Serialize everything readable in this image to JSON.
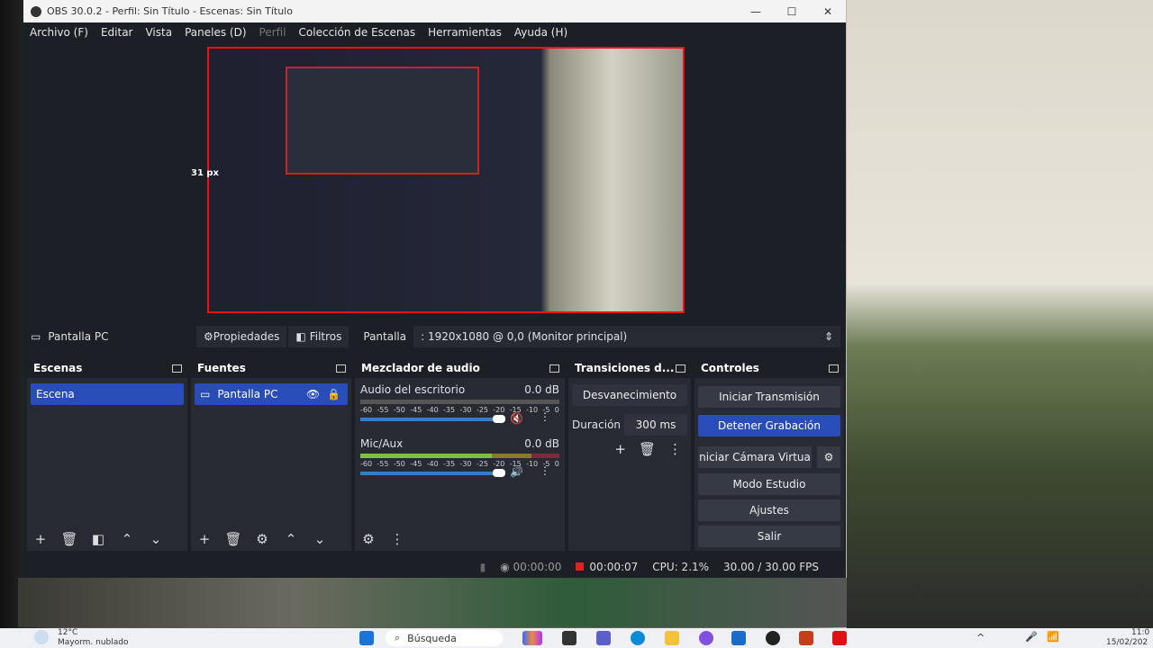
{
  "window": {
    "title": "OBS 30.0.2 - Perfil: Sin Título - Escenas: Sin Título",
    "minimize": "—",
    "maximize": "☐",
    "close": "✕"
  },
  "menu": [
    "Archivo (F)",
    "Editar",
    "Vista",
    "Paneles (D)",
    "Perfil",
    "Colección de Escenas",
    "Herramientas",
    "Ayuda (H)"
  ],
  "preview": {
    "guide_label": "31 px"
  },
  "source_bar": {
    "source": "Pantalla PC",
    "properties": "Propiedades",
    "filters": "Filtros",
    "display_label": "Pantalla",
    "display_value": ": 1920x1080 @ 0,0 (Monitor principal)"
  },
  "scenes": {
    "title": "Escenas",
    "items": [
      "Escena"
    ]
  },
  "sources": {
    "title": "Fuentes",
    "items": [
      "Pantalla PC"
    ]
  },
  "mixer": {
    "title": "Mezclador de audio",
    "ticks": [
      "-60",
      "-55",
      "-50",
      "-45",
      "-40",
      "-35",
      "-30",
      "-25",
      "-20",
      "-15",
      "-10",
      "-5",
      "0"
    ],
    "channels": [
      {
        "name": "Audio del escritorio",
        "level": "0.0 dB",
        "muted": true
      },
      {
        "name": "Mic/Aux",
        "level": "0.0 dB",
        "muted": false
      }
    ]
  },
  "transitions": {
    "title": "Transiciones d...",
    "type": "Desvanecimiento",
    "duration_label": "Duración",
    "duration": "300 ms"
  },
  "controls": {
    "title": "Controles",
    "buttons": [
      "Iniciar Transmisión",
      "Detener Grabación",
      "niciar Cámara Virtua",
      "Modo Estudio",
      "Ajustes",
      "Salir"
    ]
  },
  "status": {
    "stream_time": "00:00:00",
    "rec_time": "00:00:07",
    "cpu": "CPU: 2.1%",
    "fps": "30.00 / 30.00 FPS"
  },
  "taskbar": {
    "weather_temp": "12°C",
    "weather_desc": "Mayorm. nublado",
    "search": "Búsqueda",
    "time": "11:0",
    "date": "15/02/202"
  },
  "colors": {
    "accent": "#284cb8",
    "recording": "#dd2222",
    "selection": "#e11111"
  }
}
